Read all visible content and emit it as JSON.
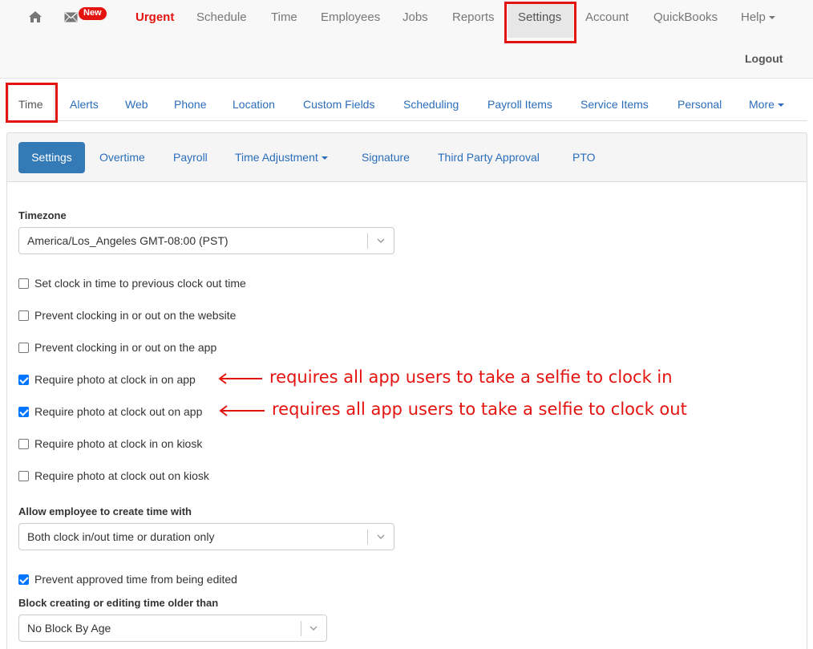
{
  "topnav": {
    "new_badge": "New",
    "items": [
      {
        "label": "Urgent"
      },
      {
        "label": "Schedule"
      },
      {
        "label": "Time"
      },
      {
        "label": "Employees"
      },
      {
        "label": "Jobs"
      },
      {
        "label": "Reports"
      },
      {
        "label": "Settings"
      },
      {
        "label": "Account"
      },
      {
        "label": "QuickBooks"
      },
      {
        "label": "Help"
      }
    ],
    "logout": "Logout",
    "icons": {
      "home": "home-icon",
      "mail": "envelope-icon"
    },
    "urgent_color": "#e4130f"
  },
  "subnav": {
    "items": [
      {
        "label": "Time"
      },
      {
        "label": "Alerts"
      },
      {
        "label": "Web"
      },
      {
        "label": "Phone"
      },
      {
        "label": "Location"
      },
      {
        "label": "Custom Fields"
      },
      {
        "label": "Scheduling"
      },
      {
        "label": "Payroll Items"
      },
      {
        "label": "Service Items"
      },
      {
        "label": "Personal"
      },
      {
        "label": "More"
      }
    ]
  },
  "tabs": {
    "items": [
      {
        "label": "Settings"
      },
      {
        "label": "Overtime"
      },
      {
        "label": "Payroll"
      },
      {
        "label": "Time Adjustment"
      },
      {
        "label": "Signature"
      },
      {
        "label": "Third Party Approval"
      },
      {
        "label": "PTO"
      }
    ],
    "active_color": "#337ab7"
  },
  "form": {
    "timezone_label": "Timezone",
    "timezone_value": "America/Los_Angeles GMT-08:00 (PST)",
    "checkboxes": [
      {
        "label": "Set clock in time to previous clock out time",
        "checked": false
      },
      {
        "label": "Prevent clocking in or out on the website",
        "checked": false
      },
      {
        "label": "Prevent clocking in or out on the app",
        "checked": false
      },
      {
        "label": "Require photo at clock in on app",
        "checked": true
      },
      {
        "label": "Require photo at clock out on app",
        "checked": true
      },
      {
        "label": "Require photo at clock in on kiosk",
        "checked": false
      },
      {
        "label": "Require photo at clock out on kiosk",
        "checked": false
      }
    ],
    "create_time_label": "Allow employee to create time with",
    "create_time_value": "Both clock in/out time or duration only",
    "prevent_edit_label": "Prevent approved time from being edited",
    "prevent_edit_checked": true,
    "block_label": "Block creating or editing time older than",
    "block_value": "No Block By Age"
  },
  "annotations": [
    {
      "text": "requires all app users to take a selfie to clock in"
    },
    {
      "text": "requires all app users to take a selfie to clock out"
    }
  ],
  "highlight_color": "#e4130f"
}
